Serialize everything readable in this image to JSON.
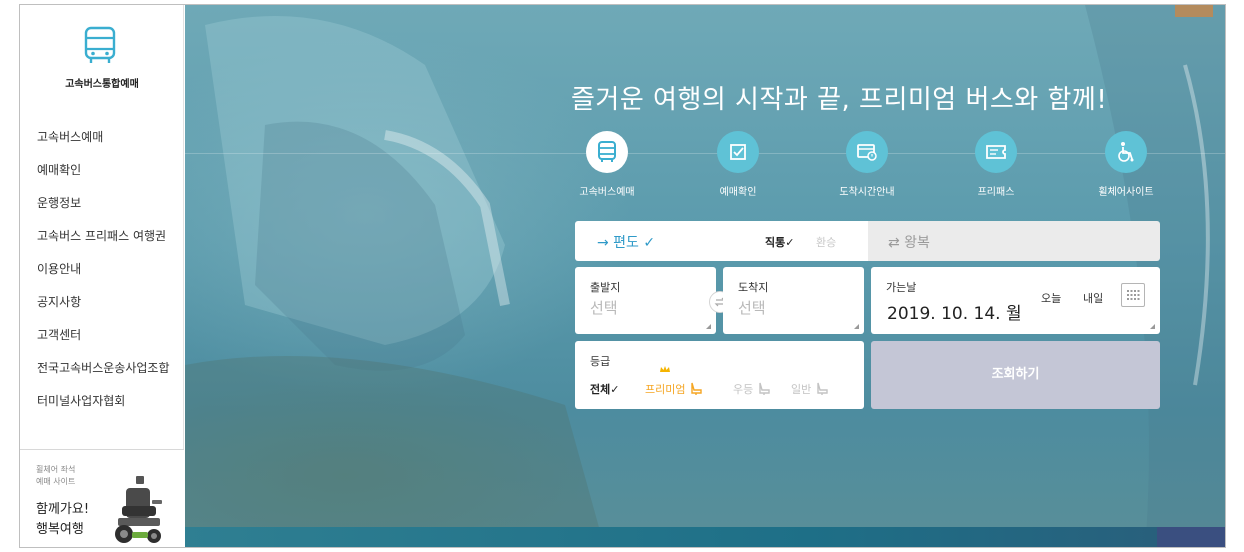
{
  "sidebar": {
    "logo_text": "고속버스통합예매",
    "items": [
      {
        "label": "고속버스예매"
      },
      {
        "label": "예매확인"
      },
      {
        "label": "운행정보"
      },
      {
        "label": "고속버스 프리패스 여행권"
      },
      {
        "label": "이용안내"
      },
      {
        "label": "공지사항"
      },
      {
        "label": "고객센터"
      },
      {
        "label": "전국고속버스운송사업조합"
      },
      {
        "label": "터미널사업자협회"
      }
    ],
    "promo": {
      "small_line1": "휠체어 좌석",
      "small_line2": "예매 사이트",
      "big_line1": "함께가요!",
      "big_line2": "행복여행"
    }
  },
  "hero": {
    "headline": "즐거운 여행의 시작과 끝, 프리미엄 버스와 함께!",
    "quick_menu": [
      {
        "label": "고속버스예매",
        "icon": "bus-icon",
        "active": true
      },
      {
        "label": "예매확인",
        "icon": "check-box-icon",
        "active": false
      },
      {
        "label": "도착시간안내",
        "icon": "arrival-time-icon",
        "active": false
      },
      {
        "label": "프리패스",
        "icon": "ticket-icon",
        "active": false
      },
      {
        "label": "휠체어사이트",
        "icon": "wheelchair-icon",
        "active": false
      }
    ]
  },
  "booking": {
    "oneway_label": "→ 편도 ✓",
    "direct_label": "직통✓",
    "transfer_label": "환승",
    "roundtrip_label": "⇄ 왕복",
    "departure": {
      "label": "출발지",
      "value": "선택"
    },
    "arrival": {
      "label": "도착지",
      "value": "선택"
    },
    "date": {
      "label": "가는날",
      "value": "2019. 10. 14. 월",
      "today": "오늘",
      "tomorrow": "내일"
    },
    "grade": {
      "label": "등급",
      "options": [
        {
          "label": "전체✓",
          "selected": true
        },
        {
          "label": "프리미엄",
          "selected": false
        },
        {
          "label": "우등",
          "selected": false
        },
        {
          "label": "일반",
          "selected": false
        }
      ]
    },
    "search_label": "조회하기"
  },
  "colors": {
    "accent": "#2f9ac8",
    "premium": "#f5a623",
    "quick_circle": "#5fc2d6",
    "search_button": "#c4c6d6"
  }
}
